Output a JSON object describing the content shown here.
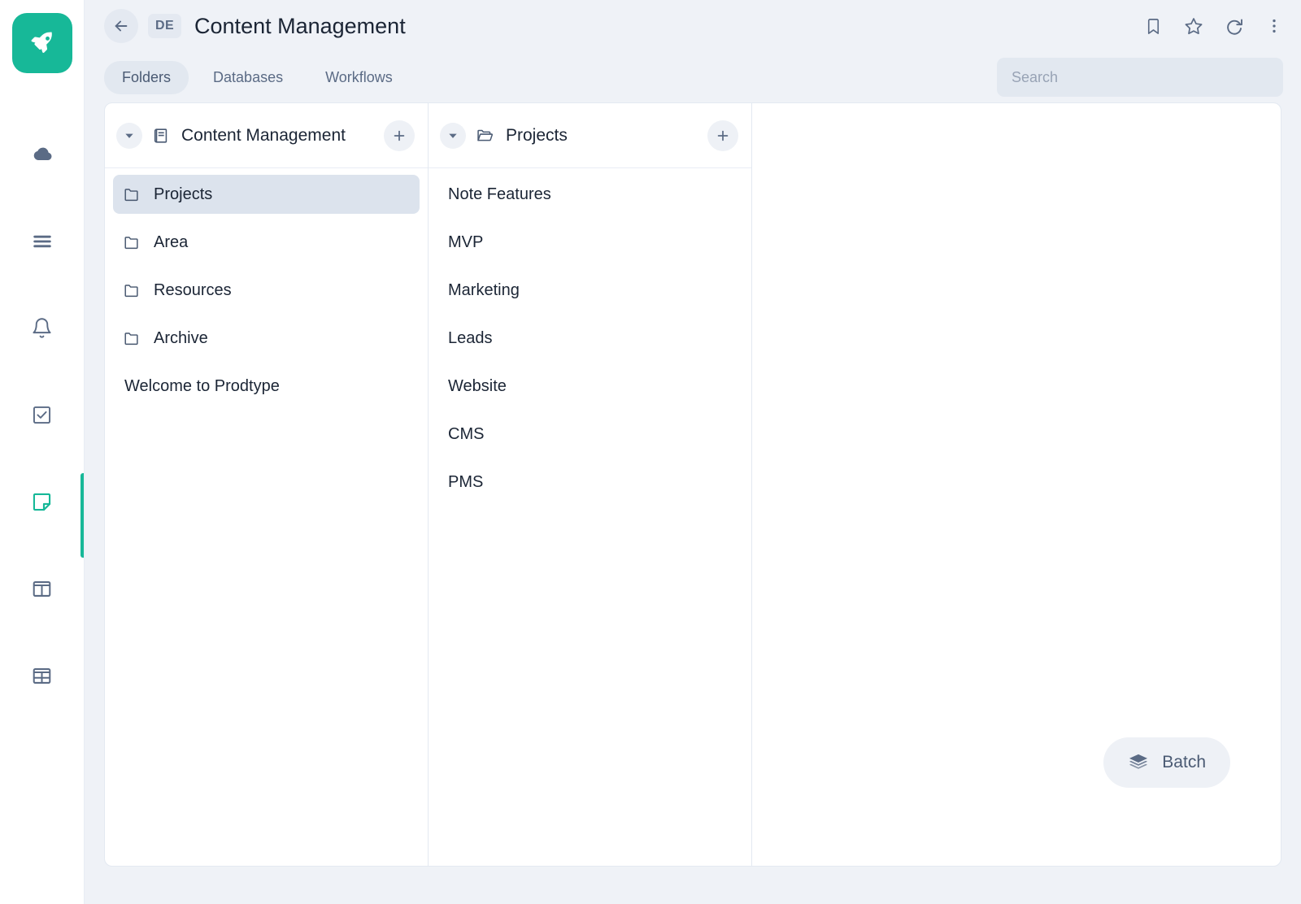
{
  "app": {
    "logo_icon": "rocket-icon",
    "accent_color": "#17b898",
    "page_background": "#eff2f7",
    "selected_row_color": "#dce3ed"
  },
  "rail": {
    "items": [
      {
        "icon": "cloud-icon",
        "active": false
      },
      {
        "icon": "menu-icon",
        "active": false
      },
      {
        "icon": "bell-icon",
        "active": false
      },
      {
        "icon": "checkbox-icon",
        "active": false
      },
      {
        "icon": "note-icon",
        "active": true
      },
      {
        "icon": "columns-layout-icon",
        "active": false
      },
      {
        "icon": "table-icon",
        "active": false
      }
    ]
  },
  "header": {
    "back_icon": "arrow-left-icon",
    "workspace_badge": "DE",
    "title": "Content Management",
    "actions": [
      {
        "icon": "bookmark-icon"
      },
      {
        "icon": "star-icon"
      },
      {
        "icon": "refresh-icon"
      },
      {
        "icon": "more-vertical-icon"
      }
    ]
  },
  "subbar": {
    "tabs": [
      {
        "label": "Folders",
        "active": true
      },
      {
        "label": "Databases",
        "active": false
      },
      {
        "label": "Workflows",
        "active": false
      }
    ],
    "search": {
      "placeholder": "Search",
      "value": ""
    }
  },
  "panels": [
    {
      "header": {
        "caret_icon": "chevron-down-icon",
        "icon": "notebook-icon",
        "title": "Content Management",
        "add_icon": "plus-icon"
      },
      "items": [
        {
          "label": "Projects",
          "icon": "folder-icon",
          "selected": true
        },
        {
          "label": "Area",
          "icon": "folder-icon",
          "selected": false
        },
        {
          "label": "Resources",
          "icon": "folder-icon",
          "selected": false
        },
        {
          "label": "Archive",
          "icon": "folder-icon",
          "selected": false
        },
        {
          "label": "Welcome to Prodtype",
          "icon": "",
          "selected": false
        }
      ]
    },
    {
      "header": {
        "caret_icon": "chevron-down-icon",
        "icon": "folder-open-icon",
        "title": "Projects",
        "add_icon": "plus-icon"
      },
      "items": [
        {
          "label": "Note Features",
          "icon": "",
          "selected": false
        },
        {
          "label": "MVP",
          "icon": "",
          "selected": false
        },
        {
          "label": "Marketing",
          "icon": "",
          "selected": false
        },
        {
          "label": "Leads",
          "icon": "",
          "selected": false
        },
        {
          "label": "Website",
          "icon": "",
          "selected": false
        },
        {
          "label": "CMS",
          "icon": "",
          "selected": false
        },
        {
          "label": "PMS",
          "icon": "",
          "selected": false
        }
      ]
    }
  ],
  "detail": {
    "batch_button": {
      "label": "Batch",
      "icon": "layers-icon"
    }
  }
}
